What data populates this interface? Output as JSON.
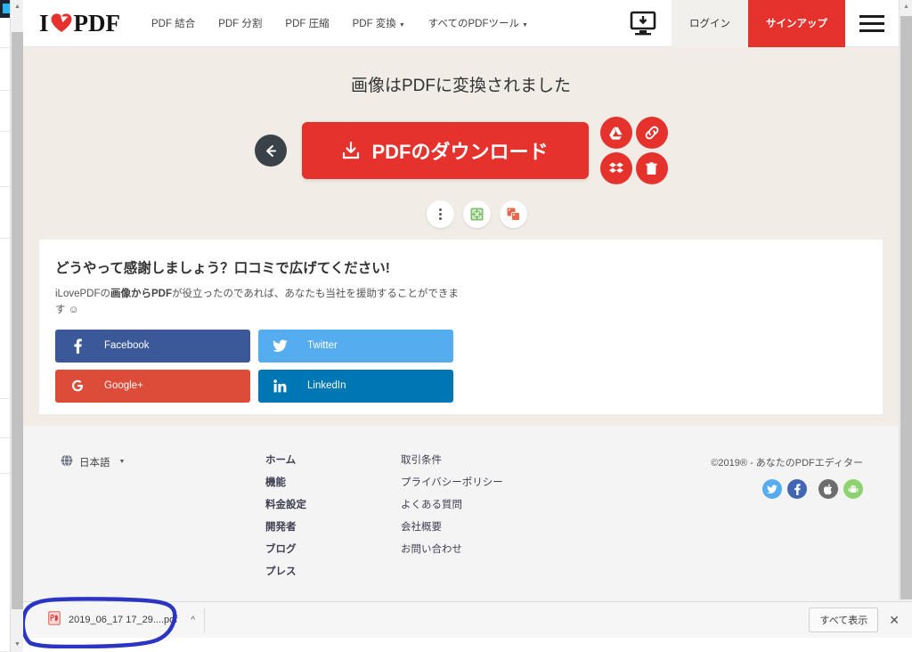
{
  "header": {
    "logo": {
      "pre": "I",
      "heart": "heart-icon",
      "post": "PDF"
    },
    "nav": [
      {
        "label": "PDF 結合",
        "caret": ""
      },
      {
        "label": "PDF 分割",
        "caret": ""
      },
      {
        "label": "PDF 圧縮",
        "caret": ""
      },
      {
        "label": "PDF 変換",
        "caret": "▼"
      },
      {
        "label": "すべてのPDFツール",
        "caret": "▼"
      }
    ],
    "desktop_app_icon": "desktop-download-icon",
    "login_label": "ログイン",
    "signup_label": "サインアップ",
    "menu_icon": "hamburger-icon"
  },
  "main": {
    "title": "画像はPDFに変換されました",
    "back_icon": "arrow-left-icon",
    "download_label": "PDFのダウンロード",
    "download_icon": "download-icon",
    "cloud_actions": [
      {
        "name": "google-drive-icon"
      },
      {
        "name": "copy-link-icon"
      },
      {
        "name": "dropbox-icon"
      },
      {
        "name": "delete-icon"
      }
    ],
    "tool_actions": [
      {
        "name": "more-options-icon"
      },
      {
        "name": "compress-pdf-icon"
      },
      {
        "name": "split-pdf-icon"
      }
    ]
  },
  "thanks": {
    "title": "どうやって感謝しましょう？口コミで広げてください!",
    "sub_pre": "iLovePDFの",
    "sub_bold1": "画像からPDF",
    "sub_mid": "が役立ったのであれば、あなたも当社を援助することができます ☺",
    "social": [
      {
        "label": "Facebook",
        "icon": "f",
        "color": "#3b5998"
      },
      {
        "label": "Twitter",
        "icon": "twitter-icon",
        "color": "#55acee"
      },
      {
        "label": "Google+",
        "icon": "G",
        "color": "#dd4b39"
      },
      {
        "label": "LinkedIn",
        "icon": "in",
        "color": "#0077b5"
      }
    ]
  },
  "footer": {
    "lang_icon": "globe-icon",
    "lang_label": "日本語",
    "lang_caret": "▼",
    "col1": [
      "ホーム",
      "機能",
      "料金設定",
      "開発者",
      "ブログ",
      "プレス"
    ],
    "col2": [
      "取引条件",
      "プライバシーポリシー",
      "よくある質問",
      "会社概要",
      "お問い合わせ"
    ],
    "copyright": "©2019® - あなたのPDFエディター",
    "social": [
      {
        "name": "twitter-icon",
        "color": "#55acee",
        "glyph": "t"
      },
      {
        "name": "facebook-icon",
        "color": "#4267b2",
        "glyph": "f"
      },
      {
        "name": "apple-icon",
        "color": "#6d6d6d",
        "glyph": "a"
      },
      {
        "name": "android-icon",
        "color": "#8ed36f",
        "glyph": "A"
      }
    ]
  },
  "download_bar": {
    "file_icon": "pdf-file-icon",
    "file_name": "2019_06_17 17_29....pdf",
    "caret": "^",
    "show_all_label": "すべて表示",
    "close_icon": "close-icon"
  },
  "colors": {
    "brand_red": "#e5322d",
    "main_bg": "#f1ece6",
    "footer_bg": "#f4f4f5",
    "annotation_blue": "#2b35c4"
  }
}
